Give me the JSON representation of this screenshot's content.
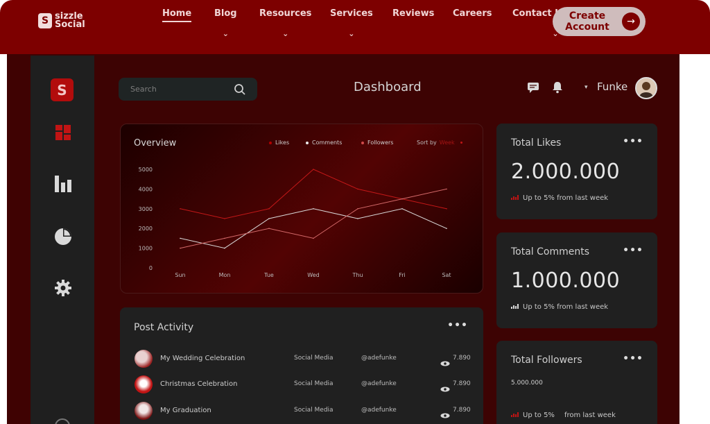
{
  "brand": {
    "line1": "sizzle",
    "line2": "Social",
    "mark": "S"
  },
  "nav": {
    "items": [
      {
        "label": "Home",
        "active": true
      },
      {
        "label": "Blog"
      },
      {
        "label": "Resources"
      },
      {
        "label": "Services"
      },
      {
        "label": "Reviews"
      },
      {
        "label": "Careers"
      },
      {
        "label": "Contact U"
      }
    ],
    "chevron": "⌄",
    "cta_line1": "Create",
    "cta_line2": "Account",
    "cta_arrow": "→"
  },
  "sidebar": {
    "logo": "S",
    "icons": [
      "dashboard-grid-icon",
      "bar-chart-icon",
      "pie-chart-icon",
      "gear-icon"
    ]
  },
  "header": {
    "search_placeholder": "Search",
    "title": "Dashboard",
    "user_caret": "▾",
    "user_name": "Funke"
  },
  "overview": {
    "title": "Overview",
    "legend": [
      {
        "label": "Likes",
        "color": "#b30000"
      },
      {
        "label": "Comments",
        "color": "#e8e8e8"
      },
      {
        "label": "Followers",
        "color": "#d04a4a"
      }
    ],
    "sort_label": "Sort by",
    "sort_value": "Week"
  },
  "chart_data": {
    "type": "line",
    "title": "Overview",
    "x": [
      "Sun",
      "Mon",
      "Tue",
      "Wed",
      "Thu",
      "Fri",
      "Sat"
    ],
    "yticks": [
      0,
      1000,
      2000,
      3000,
      4000,
      5000
    ],
    "ylim": [
      0,
      5000
    ],
    "series": [
      {
        "name": "Likes",
        "color": "#c41818",
        "values": [
          3000,
          2500,
          3000,
          5000,
          4000,
          3500,
          3000
        ]
      },
      {
        "name": "Comments",
        "color": "#d9d9d9",
        "values": [
          1500,
          1000,
          2500,
          3000,
          2500,
          3000,
          2000
        ]
      },
      {
        "name": "Followers",
        "color": "#d46a6a",
        "values": [
          1000,
          1500,
          2000,
          1500,
          3000,
          3500,
          4000
        ]
      }
    ]
  },
  "cards": {
    "likes": {
      "title": "Total Likes",
      "value": "2.000.000",
      "trend": "Up to 5% from last week"
    },
    "comments": {
      "title": "Total Comments",
      "value": "1.000.000",
      "trend": "Up to 5% from last week"
    },
    "followers": {
      "title": "Total Followers",
      "value": "5.000.000",
      "trend_a": "Up to 5%",
      "trend_b": "from last week"
    }
  },
  "more_glyph": "•••",
  "activity": {
    "title": "Post Activity",
    "rows": [
      {
        "name": "My Wedding Celebration",
        "category": "Social Media",
        "handle": "@adefunke",
        "views": "7.890"
      },
      {
        "name": "Christmas Celebration",
        "category": "Social Media",
        "handle": "@adefunke",
        "views": "7.890"
      },
      {
        "name": "My Graduation",
        "category": "Social Media",
        "handle": "@adefunke",
        "views": "7.890"
      }
    ]
  }
}
